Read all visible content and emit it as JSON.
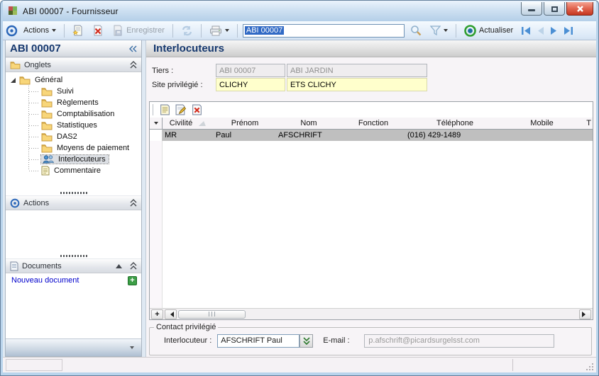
{
  "window": {
    "title": "ABI 00007 -  Fournisseur"
  },
  "toolbar": {
    "actions_label": "Actions",
    "save_label": "Enregistrer",
    "search_value": "ABI 00007",
    "refresh_label": "Actualiser"
  },
  "sidebar": {
    "header": "ABI 00007",
    "onglets_label": "Onglets",
    "actions_label": "Actions",
    "documents_label": "Documents",
    "new_document_label": "Nouveau document",
    "tree": {
      "root_label": "Général",
      "items": [
        {
          "label": "Suivi",
          "icon": "folder",
          "selected": false
        },
        {
          "label": "Règlements",
          "icon": "folder",
          "selected": false
        },
        {
          "label": "Comptabilisation",
          "icon": "folder",
          "selected": false
        },
        {
          "label": "Statistiques",
          "icon": "folder",
          "selected": false
        },
        {
          "label": "DAS2",
          "icon": "folder",
          "selected": false
        },
        {
          "label": "Moyens de paiement",
          "icon": "folder",
          "selected": false
        },
        {
          "label": "Interlocuteurs",
          "icon": "contacts",
          "selected": true
        },
        {
          "label": "Commentaire",
          "icon": "note",
          "selected": false
        }
      ]
    }
  },
  "main": {
    "title": "Interlocuteurs",
    "form": {
      "tiers_label": "Tiers  :",
      "tiers_code": "ABI 00007",
      "tiers_name": "ABI JARDIN",
      "site_label": "Site privilégié :",
      "site_code": "CLICHY",
      "site_name": "ETS CLICHY"
    },
    "table": {
      "columns": [
        "Civilité",
        "Prénom",
        "Nom",
        "Fonction",
        "Téléphone",
        "Mobile",
        "T"
      ],
      "rows": [
        [
          "MR",
          "Paul",
          "AFSCHRIFT",
          "",
          "(016) 429-1489",
          "",
          ""
        ]
      ]
    },
    "contact": {
      "group_label": "Contact privilégié",
      "interlocuteur_label": "Interlocuteur :",
      "interlocuteur_value": "AFSCHRIFT Paul",
      "email_label": "E-mail :",
      "email_value": "p.afschrift@picardsurgelsst.com"
    }
  },
  "icons": {
    "window-icon": "four-color-squares",
    "target-icon": "blue concentric circle",
    "new-record-icon": "page with yellow star",
    "delete-record-icon": "page with red x",
    "save-icon": "save page (disabled)",
    "refresh-icon": "blue double arrows (disabled)",
    "print-icon": "printer",
    "search-icon": "magnifier",
    "filter-icon": "funnel",
    "actualiser-icon": "green circular arrow",
    "nav-first-icon": "bar + left triangle",
    "nav-prev-icon": "left triangle (disabled)",
    "nav-next-icon": "right triangle",
    "nav-last-icon": "right triangle + bar",
    "folder-icon": "manila folder",
    "contacts-icon": "two blue persons",
    "note-icon": "lined page",
    "collapse-left-icon": "double chevron left",
    "collapse-up-icon": "double chevron up"
  },
  "colors": {
    "selection_blue": "#316ac5",
    "field_yellow": "#ffffcc",
    "link_blue": "#0000cc",
    "selected_row_grey": "#bfbfbf",
    "close_red": "#cf4a33",
    "accent_blue": "#3f8fd6",
    "header_text_navy": "#16386e"
  }
}
